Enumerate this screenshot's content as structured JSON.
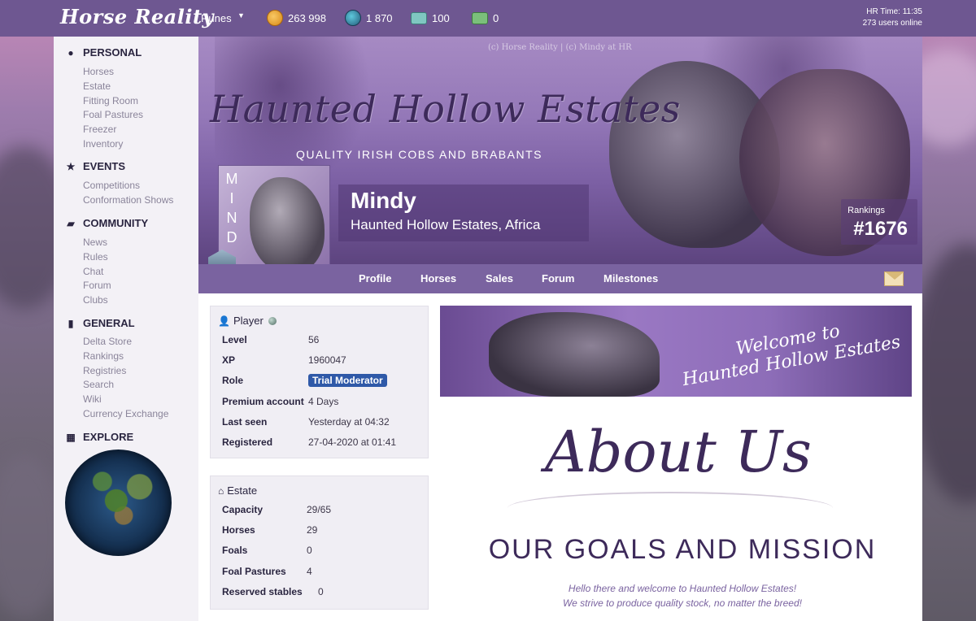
{
  "topbar": {
    "logo": "Horse Reality",
    "runes_label": "Runes",
    "currencies": {
      "coins": "263 998",
      "delta": "1 870",
      "tickets": "100",
      "passes": "0"
    },
    "hr_time": "HR Time: 11:35",
    "users_online": "273 users online"
  },
  "sidebar": {
    "personal": {
      "title": "PERSONAL",
      "items": [
        "Horses",
        "Estate",
        "Fitting Room",
        "Foal Pastures",
        "Freezer",
        "Inventory"
      ]
    },
    "events": {
      "title": "EVENTS",
      "items": [
        "Competitions",
        "Conformation Shows"
      ]
    },
    "community": {
      "title": "COMMUNITY",
      "items": [
        "News",
        "Rules",
        "Chat",
        "Forum",
        "Clubs"
      ]
    },
    "general": {
      "title": "GENERAL",
      "items": [
        "Delta Store",
        "Rankings",
        "Registries",
        "Search",
        "Wiki",
        "Currency Exchange"
      ]
    },
    "explore": {
      "title": "EXPLORE"
    }
  },
  "banner": {
    "copyright": "(c) Horse Reality | (c) Mindy at HR",
    "estate_script": "Haunted Hollow Estates",
    "estate_subtitle": "QUALITY IRISH COBS AND BRABANTS",
    "avatar_letters": [
      "M",
      "I",
      "N",
      "D"
    ],
    "player_name": "Mindy",
    "location": "Haunted Hollow Estates, Africa",
    "rankings_label": "Rankings",
    "rankings_value": "#1676"
  },
  "tabs": [
    "Profile",
    "Horses",
    "Sales",
    "Forum",
    "Milestones"
  ],
  "player_panel": {
    "title": "Player",
    "rows": [
      {
        "key": "Level",
        "value": "56"
      },
      {
        "key": "XP",
        "value": "1960047"
      },
      {
        "key": "Role",
        "value": "Trial Moderator"
      },
      {
        "key": "Premium account",
        "value": "4 Days"
      },
      {
        "key": "Last seen",
        "value": "Yesterday at 04:32"
      },
      {
        "key": "Registered",
        "value": "27-04-2020 at 01:41"
      }
    ]
  },
  "estate_panel": {
    "title": "Estate",
    "rows": [
      {
        "key": "Capacity",
        "value": "29/65"
      },
      {
        "key": "Horses",
        "value": "29"
      },
      {
        "key": "Foals",
        "value": "0"
      },
      {
        "key": "Foal Pastures",
        "value": "4"
      },
      {
        "key": "Reserved stables",
        "value": "0"
      }
    ]
  },
  "welcome_banner": {
    "line1": "Welcome to",
    "line2": "Haunted Hollow Estates"
  },
  "about": {
    "title": "About Us",
    "subtitle": "OUR GOALS AND MISSION",
    "text_line1": "Hello there and welcome to Haunted Hollow Estates!",
    "text_line2": "We strive to produce quality stock, no matter the breed!"
  },
  "colors": {
    "topbar": "#6e5791",
    "tabs": "#7a63a0",
    "role_badge": "#2f59a8",
    "accent_text": "#3d2a5a"
  }
}
